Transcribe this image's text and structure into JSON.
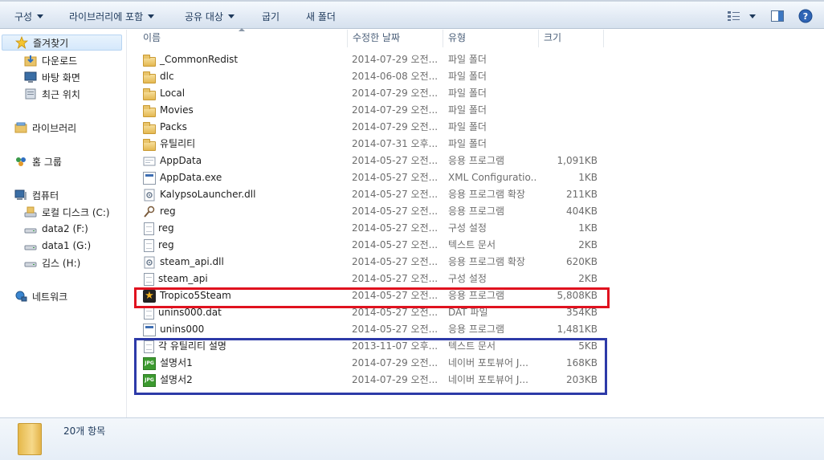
{
  "toolbar": {
    "organize": "구성",
    "include_in_library": "라이브러리에 포함",
    "share_with": "공유 대상",
    "burn": "굽기",
    "new_folder": "새 폴더"
  },
  "nav": {
    "favorites": "즐겨찾기",
    "downloads": "다운로드",
    "desktop": "바탕 화면",
    "recent": "최근 위치",
    "libraries": "라이브러리",
    "homegroup": "홈 그룹",
    "computer": "컴퓨터",
    "local_disk": "로컬 디스크 (C:)",
    "data2": "data2 (F:)",
    "data1": "data1 (G:)",
    "kimsu": "김스  (H:)",
    "network": "네트워크"
  },
  "columns": {
    "name": "이름",
    "date": "수정한 날짜",
    "type": "유형",
    "size": "크기"
  },
  "files": [
    {
      "name": "_CommonRedist",
      "date": "2014-07-29 오전...",
      "type": "파일 폴더",
      "size": "",
      "icon": "folder"
    },
    {
      "name": "dlc",
      "date": "2014-06-08 오전...",
      "type": "파일 폴더",
      "size": "",
      "icon": "folder"
    },
    {
      "name": "Local",
      "date": "2014-07-29 오전...",
      "type": "파일 폴더",
      "size": "",
      "icon": "folder"
    },
    {
      "name": "Movies",
      "date": "2014-07-29 오전...",
      "type": "파일 폴더",
      "size": "",
      "icon": "folder"
    },
    {
      "name": "Packs",
      "date": "2014-07-29 오전...",
      "type": "파일 폴더",
      "size": "",
      "icon": "folder"
    },
    {
      "name": "유틸리티",
      "date": "2014-07-31 오후...",
      "type": "파일 폴더",
      "size": "",
      "icon": "folder"
    },
    {
      "name": "AppData",
      "date": "2014-05-27 오전...",
      "type": "응용 프로그램",
      "size": "1,091KB",
      "icon": "app"
    },
    {
      "name": "AppData.exe",
      "date": "2014-05-27 오전...",
      "type": "XML Configuratio...",
      "size": "1KB",
      "icon": "exe"
    },
    {
      "name": "KalypsoLauncher.dll",
      "date": "2014-05-27 오전...",
      "type": "응용 프로그램 확장",
      "size": "211KB",
      "icon": "dll"
    },
    {
      "name": "reg",
      "date": "2014-05-27 오전...",
      "type": "응용 프로그램",
      "size": "404KB",
      "icon": "reg"
    },
    {
      "name": "reg",
      "date": "2014-05-27 오전...",
      "type": "구성 설정",
      "size": "1KB",
      "icon": "doc"
    },
    {
      "name": "reg",
      "date": "2014-05-27 오전...",
      "type": "텍스트 문서",
      "size": "2KB",
      "icon": "doc"
    },
    {
      "name": "steam_api.dll",
      "date": "2014-05-27 오전...",
      "type": "응용 프로그램 확장",
      "size": "620KB",
      "icon": "dll"
    },
    {
      "name": "steam_api",
      "date": "2014-05-27 오전...",
      "type": "구성 설정",
      "size": "2KB",
      "icon": "doc"
    },
    {
      "name": "Tropico5Steam",
      "date": "2014-05-27 오전...",
      "type": "응용 프로그램",
      "size": "5,808KB",
      "icon": "star"
    },
    {
      "name": "unins000.dat",
      "date": "2014-05-27 오전...",
      "type": "DAT 파일",
      "size": "354KB",
      "icon": "doc"
    },
    {
      "name": "unins000",
      "date": "2014-05-27 오전...",
      "type": "응용 프로그램",
      "size": "1,481KB",
      "icon": "exe"
    },
    {
      "name": "각 유틸리티 설명",
      "date": "2013-11-07 오후...",
      "type": "텍스트 문서",
      "size": "5KB",
      "icon": "doc"
    },
    {
      "name": "설명서1",
      "date": "2014-07-29 오전...",
      "type": "네이버 포토뷰어 J...",
      "size": "168KB",
      "icon": "jpg"
    },
    {
      "name": "설명서2",
      "date": "2014-07-29 오전...",
      "type": "네이버 포토뷰어 J...",
      "size": "203KB",
      "icon": "jpg"
    }
  ],
  "details": {
    "item_count": "20개 항목"
  },
  "colors": {
    "highlight_red": "#e0121f",
    "highlight_blue": "#2d3aa8",
    "toolbar_text": "#1e395b"
  }
}
